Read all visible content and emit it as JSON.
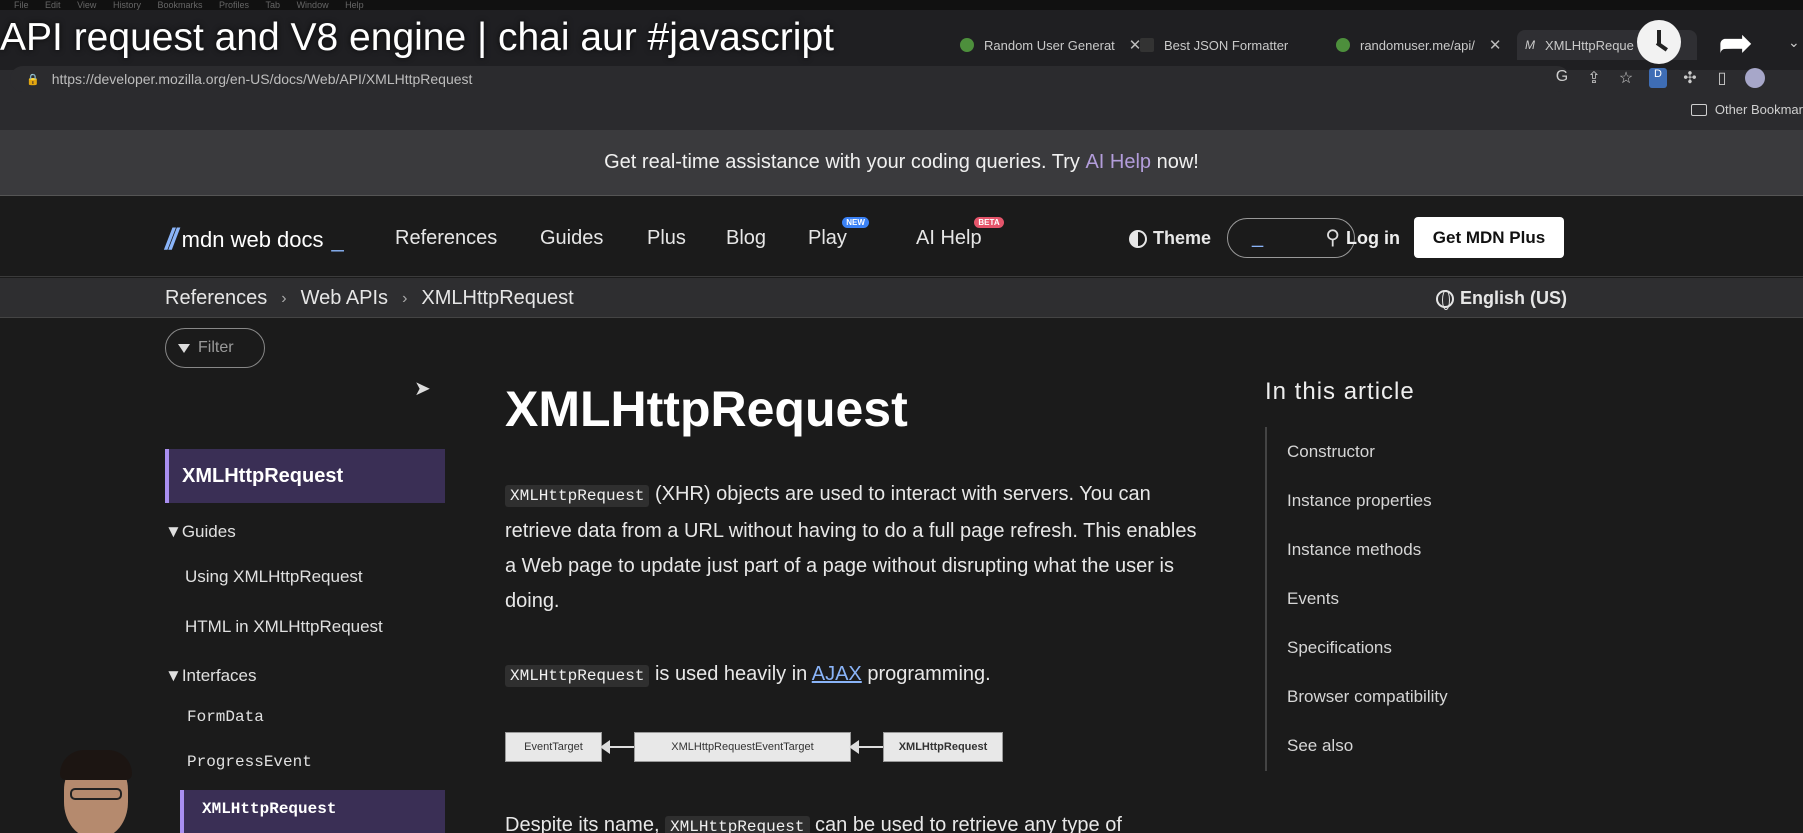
{
  "video": {
    "title": "API request and V8 engine | chai aur #javascript"
  },
  "os_menu": [
    "File",
    "Edit",
    "View",
    "History",
    "Bookmarks",
    "Profiles",
    "Tab",
    "Window",
    "Help"
  ],
  "browser": {
    "tabs": [
      {
        "label": "Random User Generat",
        "icon": "green-circle-icon"
      },
      {
        "label": "Best JSON Formatter",
        "icon": "jt-icon"
      },
      {
        "label": "randomuser.me/api/",
        "icon": "green-circle-icon"
      },
      {
        "label": "XMLHttpReque",
        "icon": "mdn-icon",
        "active": true
      }
    ],
    "url": "https://developer.mozilla.org/en-US/docs/Web/API/XMLHttpRequest",
    "bookmark_folder": "Other Bookmar"
  },
  "banner": {
    "text_before": "Get real-time assistance with your coding queries. Try ",
    "link": "AI Help",
    "text_after": " now!"
  },
  "nav": {
    "logo": "mdn web docs",
    "logo_cursor": "_",
    "links": [
      "References",
      "Guides",
      "Plus",
      "Blog",
      "Play",
      "AI Help"
    ],
    "play_badge": "NEW",
    "ai_badge": "BETA",
    "theme": "Theme",
    "login": "Log in",
    "get_plus": "Get MDN Plus"
  },
  "breadcrumb": [
    "References",
    "Web APIs",
    "XMLHttpRequest"
  ],
  "language": "English (US)",
  "sidebar": {
    "filter_placeholder": "Filter",
    "active": "XMLHttpRequest",
    "guides_heading": "▼Guides",
    "guides": [
      "Using XMLHttpRequest",
      "HTML in XMLHttpRequest"
    ],
    "interfaces_heading": "▼Interfaces",
    "interfaces": [
      "FormData",
      "ProgressEvent"
    ],
    "interfaces_active": "XMLHttpRequest"
  },
  "article": {
    "title": "XMLHttpRequest",
    "p1_code": "XMLHttpRequest",
    "p1_text": " (XHR) objects are used to interact with servers. You can retrieve data from a URL without having to do a full page refresh. This enables a Web page to update just part of a page without disrupting what the user is doing.",
    "p2_code": "XMLHttpRequest",
    "p2_mid": " is used heavily in ",
    "p2_link": "AJAX",
    "p2_end": " programming.",
    "diagram": [
      "EventTarget",
      "XMLHttpRequestEventTarget",
      "XMLHttpRequest"
    ],
    "p3_start": "Despite its name, ",
    "p3_code": "XMLHttpRequest",
    "p3_end": " can be used to retrieve any type of"
  },
  "toc": {
    "title": "In this article",
    "items": [
      "Constructor",
      "Instance properties",
      "Instance methods",
      "Events",
      "Specifications",
      "Browser compatibility",
      "See also"
    ]
  }
}
